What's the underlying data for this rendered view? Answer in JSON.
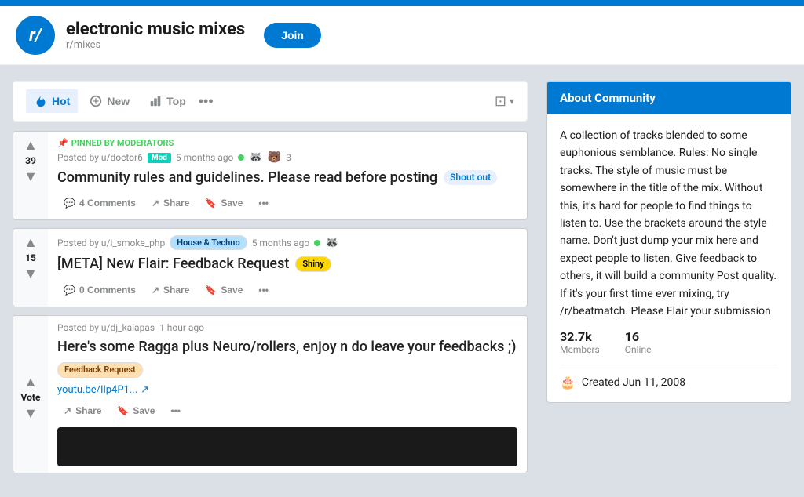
{
  "topbar": {},
  "header": {
    "logo_text": "r/",
    "subreddit_name": "electronic music mixes",
    "sub_handle": "r/mixes",
    "join_label": "Join"
  },
  "sort_bar": {
    "hot_label": "Hot",
    "new_label": "New",
    "top_label": "Top",
    "more_icon": "•••",
    "view_icon": "⊡"
  },
  "posts": [
    {
      "id": "post1",
      "pinned": true,
      "pinned_label": "PINNED BY MODERATORS",
      "meta": "Posted by u/doctor6",
      "mod_badge": "Mod",
      "time": "5 months ago",
      "has_online": true,
      "awards": "3",
      "vote_count": "39",
      "title": "Community rules and guidelines. Please read before posting",
      "flair": "Shout out",
      "flair_class": "shout-out-tag",
      "comments_label": "4 Comments",
      "share_label": "Share",
      "save_label": "Save",
      "more": "•••"
    },
    {
      "id": "post2",
      "pinned": false,
      "meta": "Posted by u/i_smoke_php",
      "flair_pre": "House & Techno",
      "flair_pre_class": "flair-house",
      "time": "5 months ago",
      "has_online": true,
      "vote_count": "15",
      "title": "[META] New Flair: Feedback Request",
      "flair": "Shiny",
      "flair_class": "flair-shiny",
      "comments_label": "0 Comments",
      "share_label": "Share",
      "save_label": "Save",
      "more": "•••"
    },
    {
      "id": "post3",
      "pinned": false,
      "meta": "Posted by u/dj_kalapas",
      "time": "1 hour ago",
      "vote_label": "Vote",
      "title": "Here's some Ragga plus Neuro/rollers, enjoy n do leave your feedbacks ;)",
      "flair": "Feedback Request",
      "flair_class": "flair-feedback",
      "link": "youtu.be/Ilp4P1...",
      "comments_label": "",
      "share_label": "Share",
      "save_label": "Save",
      "more": "•••"
    }
  ],
  "sidebar": {
    "about_title": "About Community",
    "description": "A collection of tracks blended to some euphonious semblance. Rules: No single tracks. The style of music must be somewhere in the title of the mix. Without this, it's hard for people to find things to listen to. Use the brackets around the style name. Don't just dump your mix here and expect people to listen. Give feedback to others, it will build a community Post quality. If it's your first time ever mixing, try /r/beatmatch. Please Flair your submission",
    "members_count": "32.7k",
    "members_label": "Members",
    "online_count": "16",
    "online_label": "Online",
    "created_label": "Created Jun 11, 2008"
  }
}
